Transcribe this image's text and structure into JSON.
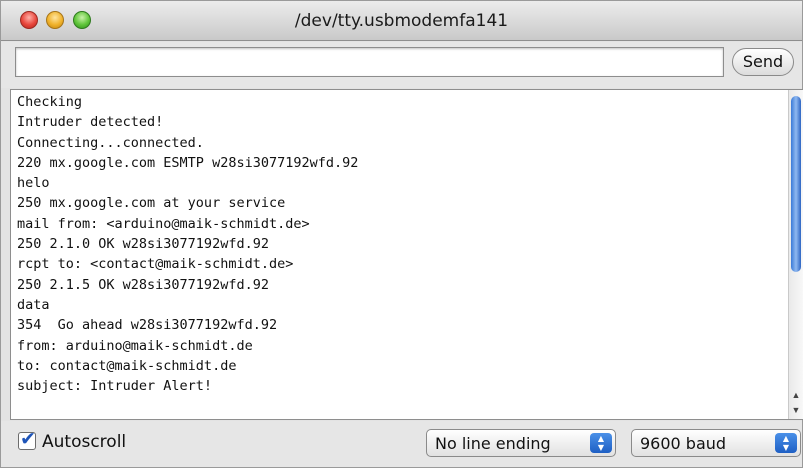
{
  "window": {
    "title": "/dev/tty.usbmodemfa141"
  },
  "toolbar": {
    "input_value": "",
    "send_label": "Send"
  },
  "console": {
    "lines": [
      "Checking",
      "Intruder detected!",
      "Connecting...connected.",
      "220 mx.google.com ESMTP w28si3077192wfd.92",
      "helo",
      "250 mx.google.com at your service",
      "mail from: <arduino@maik-schmidt.de>",
      "250 2.1.0 OK w28si3077192wfd.92",
      "rcpt to: <contact@maik-schmidt.de>",
      "250 2.1.5 OK w28si3077192wfd.92",
      "data",
      "354  Go ahead w28si3077192wfd.92",
      "from: arduino@maik-schmidt.de",
      "to: contact@maik-schmidt.de",
      "subject: Intruder Alert!"
    ]
  },
  "bottom": {
    "autoscroll_label": "Autoscroll",
    "autoscroll_checked": true,
    "line_ending": "No line ending",
    "baud": "9600 baud"
  },
  "icons": {
    "close": "close-traffic-light",
    "minimize": "minimize-traffic-light",
    "zoom": "zoom-traffic-light",
    "stepper": "up-down-chevrons",
    "check": "checkmark"
  }
}
